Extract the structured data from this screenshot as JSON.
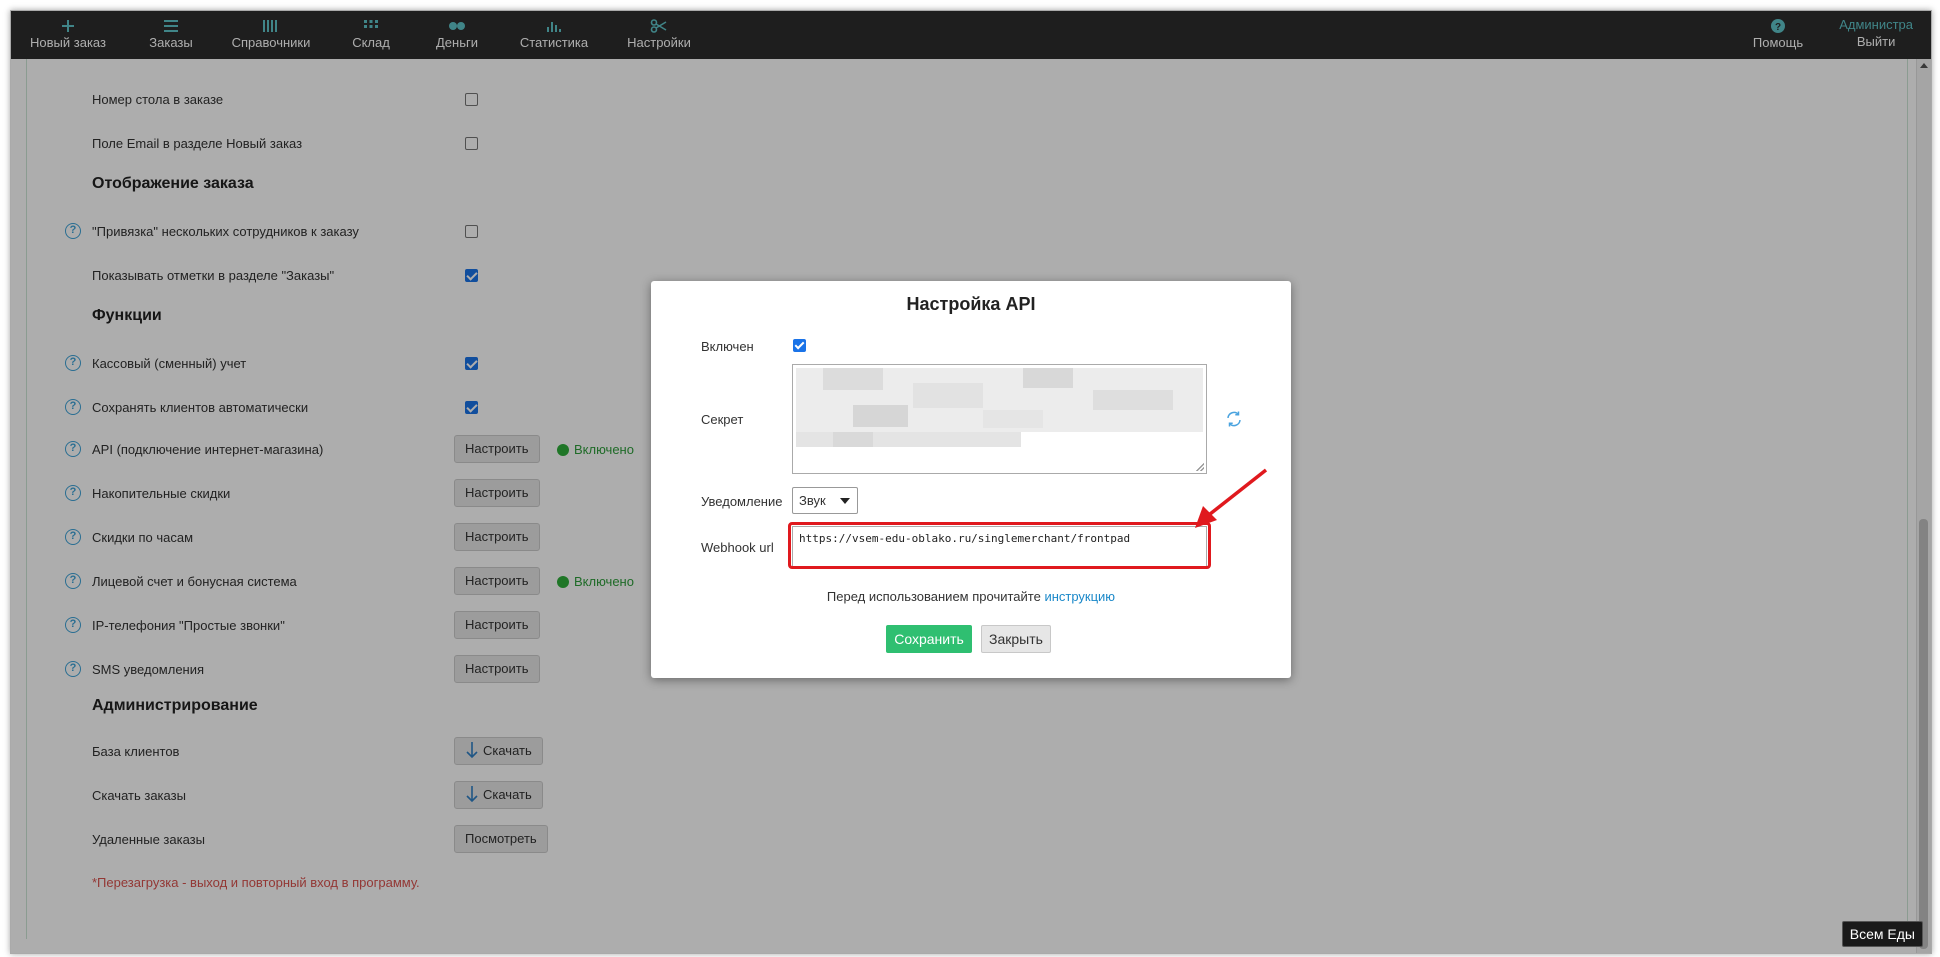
{
  "nav": {
    "items": [
      {
        "label": "Новый заказ",
        "icon": "plus-icon"
      },
      {
        "label": "Заказы",
        "icon": "list-icon"
      },
      {
        "label": "Справочники",
        "icon": "columns-icon"
      },
      {
        "label": "Склад",
        "icon": "grid-icon"
      },
      {
        "label": "Деньги",
        "icon": "coins-icon"
      },
      {
        "label": "Статистика",
        "icon": "bar-chart-icon"
      },
      {
        "label": "Настройки",
        "icon": "scissors-icon"
      },
      {
        "label": "Помощь",
        "icon": "help-icon"
      }
    ],
    "user": "Администра",
    "logout": "Выйти",
    "accent_color": "#5fc4c9",
    "bg_color": "#2d2d2d"
  },
  "settings": {
    "rows_top": [
      {
        "label": "Номер стола в заказе",
        "checked": false,
        "help": false
      },
      {
        "label": "Поле Email в разделе Новый заказ",
        "checked": false,
        "help": false
      }
    ],
    "section_display": "Отображение заказа",
    "rows_display": [
      {
        "label": "\"Привязка\" нескольких сотрудников к заказу",
        "checked": false,
        "help": true
      },
      {
        "label": "Показывать отметки в разделе \"Заказы\"",
        "checked": true,
        "help": false
      }
    ],
    "section_functions": "Функции",
    "rows_functions": [
      {
        "label": "Кассовый (сменный) учет",
        "checked": true,
        "help": true
      },
      {
        "label": "Сохранять клиентов автоматически",
        "checked": true,
        "help": true
      }
    ],
    "rows_configurable": [
      {
        "label": "API (подключение интернет-магазина)",
        "button": "Настроить",
        "status": "Включено"
      },
      {
        "label": "Накопительные скидки",
        "button": "Настроить",
        "status": ""
      },
      {
        "label": "Скидки по часам",
        "button": "Настроить",
        "status": ""
      },
      {
        "label": "Лицевой счет и бонусная система",
        "button": "Настроить",
        "status": "Включено"
      },
      {
        "label": "IP-телефония \"Простые звонки\"",
        "button": "Настроить",
        "status": ""
      },
      {
        "label": "SMS уведомления",
        "button": "Настроить",
        "status": ""
      }
    ],
    "section_admin": "Администрирование",
    "rows_admin": [
      {
        "label": "База клиентов",
        "button": "Скачать"
      },
      {
        "label": "Скачать заказы",
        "button": "Скачать"
      },
      {
        "label": "Удаленные заказы",
        "button": "Посмотреть"
      }
    ],
    "note": "*Перезагрузка - выход и повторный вход в программу."
  },
  "modal": {
    "title": "Настройка API",
    "enabled_label": "Включен",
    "enabled": true,
    "secret_label": "Секрет",
    "notify_label": "Уведомление",
    "notify_value": "Звук",
    "webhook_label": "Webhook url",
    "webhook_value": "https://vsem-edu-oblako.ru/singlemerchant/frontpad",
    "hint_text": "Перед использованием прочитайте ",
    "hint_link": "инструкцию",
    "save_label": "Сохранить",
    "close_label": "Закрыть",
    "save_color": "#2fbf71",
    "highlight_color": "#e0191e"
  },
  "badge": "Всем Еды"
}
